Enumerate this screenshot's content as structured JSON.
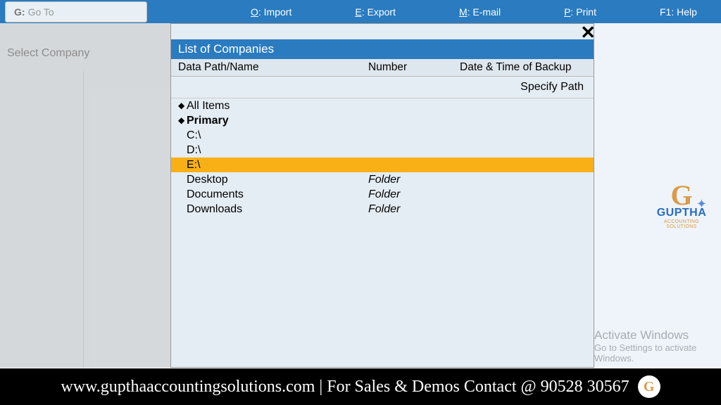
{
  "topbar": {
    "goto_key": "G:",
    "goto_label": "Go To",
    "menu": {
      "import_key": "O",
      "import_label": ": Import",
      "export_key": "E",
      "export_label": ": Export",
      "email_key": "M",
      "email_label": ": E-mail",
      "print_key": "P",
      "print_label": ": Print",
      "help_key": "F1",
      "help_label": ": Help"
    }
  },
  "sidebar": {
    "select_company": "Select Company"
  },
  "popup": {
    "title": "List of Companies",
    "headers": {
      "path": "Data Path/Name",
      "number": "Number",
      "date": "Date & Time of Backup"
    },
    "specify_path": "Specify Path",
    "rows": {
      "all_items": "All Items",
      "primary": "Primary",
      "c_drive": "C:\\",
      "d_drive": "D:\\",
      "e_drive": "E:\\",
      "desktop": "Desktop",
      "desktop_type": "Folder",
      "documents": "Documents",
      "documents_type": "Folder",
      "downloads": "Downloads",
      "downloads_type": "Folder"
    },
    "close": "✕"
  },
  "branding": {
    "logo_g": "G",
    "logo_name": "GUPTHA",
    "logo_sub": "ACCOUNTING SOLUTIONS"
  },
  "watermark": {
    "title": "Activate Windows",
    "sub": "Go to Settings to activate Windows."
  },
  "banner": {
    "text": "www.gupthaaccountingsolutions.com | For Sales & Demos Contact @ 90528 30567",
    "icon_letter": "G"
  }
}
